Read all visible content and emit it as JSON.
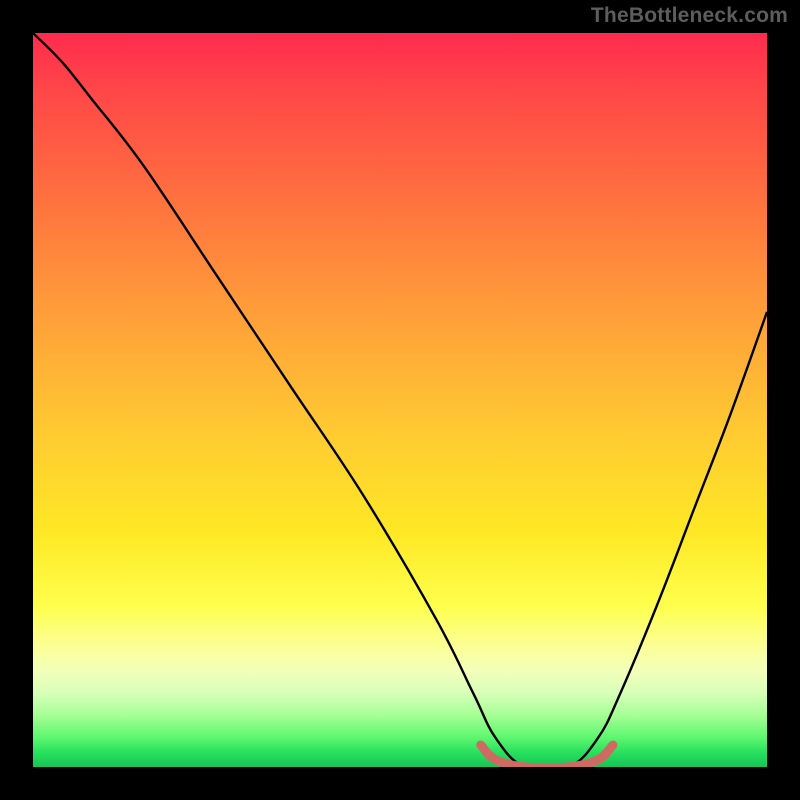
{
  "watermark": "TheBottleneck.com",
  "gradient": {
    "stops": [
      {
        "pct": 0,
        "color": "#ff2b4e"
      },
      {
        "pct": 8,
        "color": "#ff4748"
      },
      {
        "pct": 22,
        "color": "#ff6f3f"
      },
      {
        "pct": 36,
        "color": "#ff983a"
      },
      {
        "pct": 54,
        "color": "#ffc932"
      },
      {
        "pct": 68,
        "color": "#fee825"
      },
      {
        "pct": 78,
        "color": "#feff4c"
      },
      {
        "pct": 84,
        "color": "#fbff9b"
      },
      {
        "pct": 87,
        "color": "#f2ffba"
      },
      {
        "pct": 90,
        "color": "#d6ffb8"
      },
      {
        "pct": 93,
        "color": "#a4ff94"
      },
      {
        "pct": 96,
        "color": "#5cf76f"
      },
      {
        "pct": 98,
        "color": "#28e05e"
      },
      {
        "pct": 100,
        "color": "#17c455"
      }
    ]
  },
  "chart_data": {
    "type": "line",
    "title": "",
    "xlabel": "",
    "ylabel": "",
    "xlim": [
      0,
      100
    ],
    "ylim": [
      0,
      100
    ],
    "series": [
      {
        "name": "bottleneck-curve",
        "x": [
          0,
          4,
          8,
          15,
          25,
          35,
          45,
          55,
          60,
          63,
          67,
          73,
          77,
          80,
          85,
          90,
          95,
          100
        ],
        "values": [
          100,
          96,
          91,
          82,
          67,
          52,
          37,
          20,
          10,
          4,
          0,
          0,
          4,
          10,
          22,
          35,
          48,
          62
        ]
      },
      {
        "name": "flat-bottom-highlight",
        "x": [
          61,
          63,
          67,
          73,
          77,
          79
        ],
        "values": [
          3,
          1,
          0,
          0,
          1,
          3
        ]
      }
    ],
    "annotations": [
      {
        "text": "TheBottleneck.com",
        "position": "top-right"
      }
    ]
  },
  "colors": {
    "curve": "#000000",
    "highlight": "#cf6a62",
    "frame": "#000000"
  }
}
